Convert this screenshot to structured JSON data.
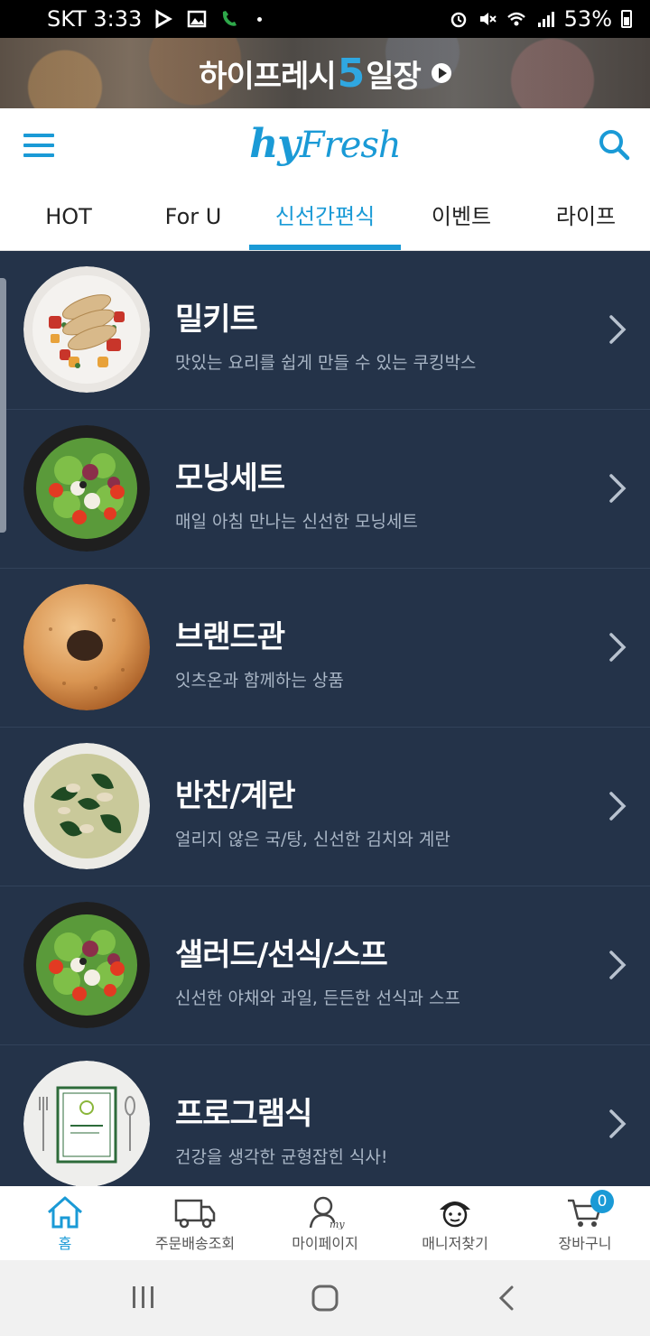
{
  "status_bar": {
    "carrier_time": "SKT 3:33",
    "battery": "53%"
  },
  "banner": {
    "text_before": "하이프레시",
    "text_num": "5",
    "text_after": "일장"
  },
  "header": {
    "logo_hy": "hy",
    "logo_fresh": "Fresh"
  },
  "tabs": [
    {
      "label": "HOT"
    },
    {
      "label": "For U"
    },
    {
      "label": "신선간편식",
      "active": true
    },
    {
      "label": "이벤트"
    },
    {
      "label": "라이프"
    }
  ],
  "categories": [
    {
      "title": "밀키트",
      "subtitle": "맛있는 요리를 쉽게 만들 수 있는 쿠킹박스",
      "icon": "chicken-salad-plate"
    },
    {
      "title": "모닝세트",
      "subtitle": "매일 아침 만나는 신선한 모닝세트",
      "icon": "green-salad-bowl"
    },
    {
      "title": "브랜드관",
      "subtitle": "잇츠온과 함께하는 상품",
      "icon": "bagel"
    },
    {
      "title": "반찬/계란",
      "subtitle": "얼리지 않은 국/탕, 신선한 김치와 계란",
      "icon": "seaweed-soup"
    },
    {
      "title": "샐러드/선식/스프",
      "subtitle": "신선한 야채와 과일, 든든한 선식과 스프",
      "icon": "green-salad-bowl"
    },
    {
      "title": "프로그램식",
      "subtitle": "건강을 생각한 균형잡힌 식사!",
      "icon": "program-meal"
    }
  ],
  "bottom_nav": [
    {
      "label": "홈",
      "icon": "home-icon",
      "active": true
    },
    {
      "label": "주문배송조회",
      "icon": "truck-icon"
    },
    {
      "label": "마이페이지",
      "icon": "my-page-icon"
    },
    {
      "label": "매니저찾기",
      "icon": "manager-icon"
    },
    {
      "label": "장바구니",
      "icon": "cart-icon",
      "badge": "0"
    }
  ],
  "colors": {
    "accent": "#1a9ad6",
    "list_bg": "#243349"
  }
}
